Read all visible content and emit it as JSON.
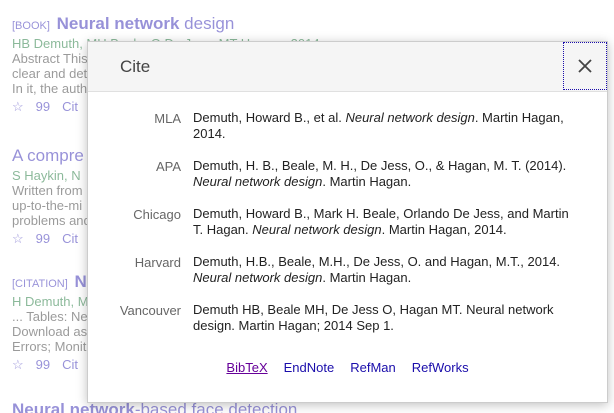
{
  "background": {
    "results": [
      {
        "tag": "[BOOK]",
        "title_bold": "Neural network",
        "title_rest": " design",
        "authors": "HB Demuth, MH Beale, O De Jess, MT Hagan - 2014",
        "snippet": [
          "Abstract This",
          "clear and det",
          "In it, the auth"
        ],
        "actions": [
          "☆",
          "99",
          "Cit"
        ]
      },
      {
        "tag": "",
        "title_bold": "",
        "title_rest": "A compre",
        "authors": "S Haykin, N",
        "snippet": [
          "Written from",
          "up-to-the-mi",
          "problems and"
        ],
        "actions": [
          "☆",
          "99",
          "Cit"
        ]
      },
      {
        "tag": "[CITATION]",
        "title_bold": "N",
        "title_rest": "",
        "authors": "H Demuth, M",
        "snippet": [
          "... Tables: Ne",
          "Download as",
          "Errors; Monit"
        ],
        "actions": [
          "☆",
          "99",
          "Cit"
        ]
      },
      {
        "tag": "",
        "title_bold": "Neural network",
        "title_rest": "-based face detection",
        "authors": "",
        "snippet": [],
        "actions": []
      }
    ]
  },
  "modal": {
    "title": "Cite",
    "close_icon": "close-x-icon",
    "citations": [
      {
        "format": "MLA",
        "pre": "Demuth, Howard B., et al. ",
        "italic": "Neural network design",
        "post": ". Martin Hagan, 2014."
      },
      {
        "format": "APA",
        "pre": "Demuth, H. B., Beale, M. H., De Jess, O., & Hagan, M. T. (2014). ",
        "italic": "Neural network design",
        "post": ". Martin Hagan."
      },
      {
        "format": "Chicago",
        "pre": "Demuth, Howard B., Mark H. Beale, Orlando De Jess, and Martin T. Hagan. ",
        "italic": "Neural network design",
        "post": ". Martin Hagan, 2014."
      },
      {
        "format": "Harvard",
        "pre": "Demuth, H.B., Beale, M.H., De Jess, O. and Hagan, M.T., 2014. ",
        "italic": "Neural network design",
        "post": ". Martin Hagan."
      },
      {
        "format": "Vancouver",
        "pre": "Demuth HB, Beale MH, De Jess O, Hagan MT. Neural network design. Martin Hagan; 2014 Sep 1.",
        "italic": "",
        "post": ""
      }
    ],
    "export_links": [
      "BibTeX",
      "EndNote",
      "RefMan",
      "RefWorks"
    ]
  }
}
